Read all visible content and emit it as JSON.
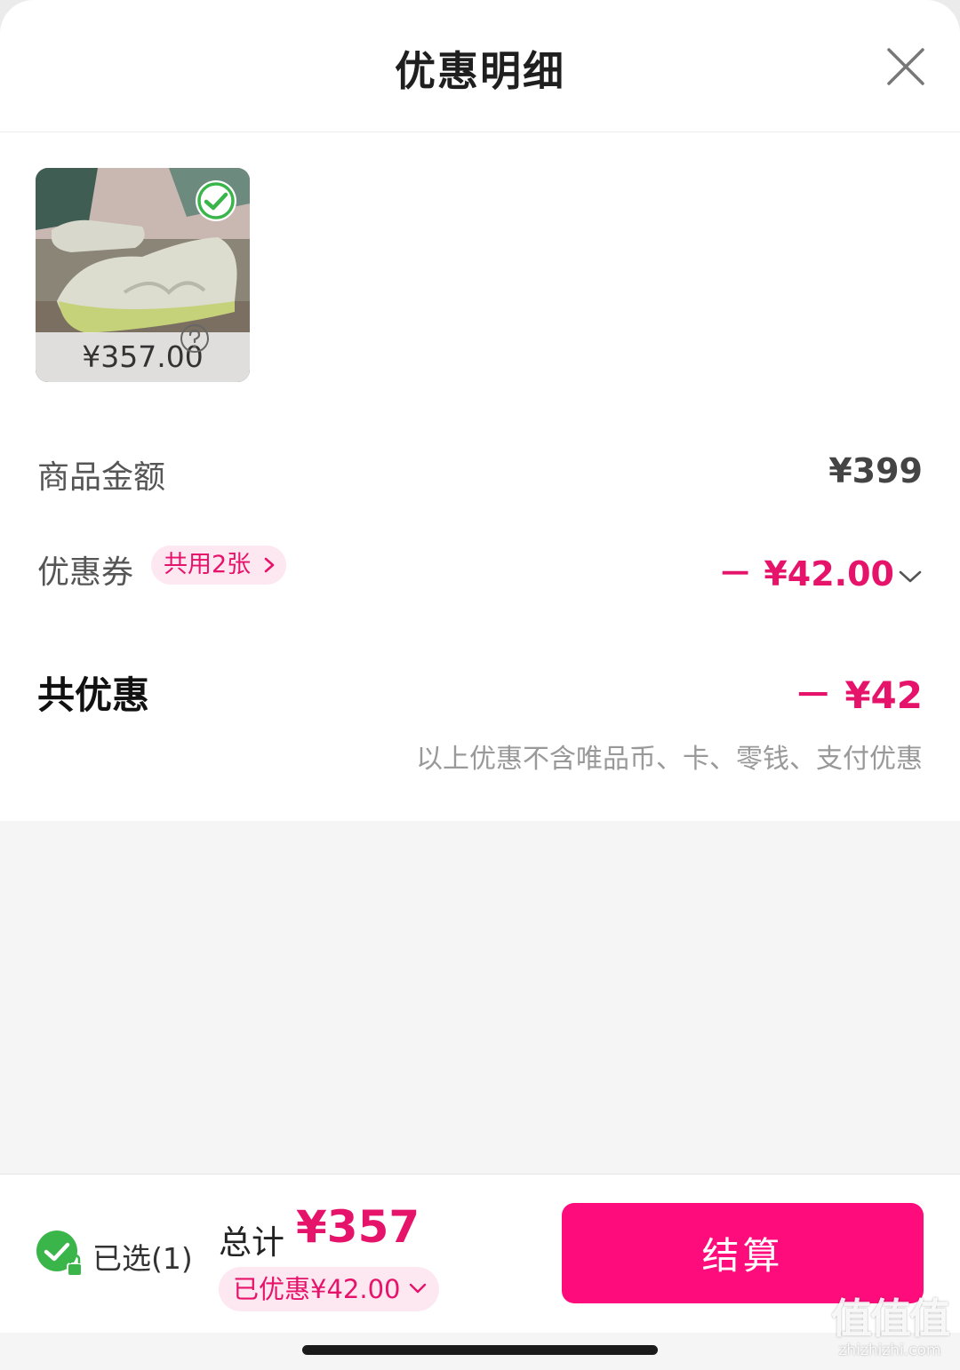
{
  "header": {
    "title": "优惠明细",
    "close_icon": "close-icon"
  },
  "product": {
    "price": "¥357.00",
    "selected": true,
    "image": "running-shoe-photo"
  },
  "rows": {
    "goods_amount": {
      "label": "商品金额",
      "value": "¥399",
      "help_icon": "question-circle-icon"
    },
    "coupon": {
      "label": "优惠券",
      "pill": "共用2张",
      "value": "－ ¥42.00"
    }
  },
  "total_discount": {
    "label": "共优惠",
    "value": "－ ¥42"
  },
  "note": "以上优惠不含唯品币、卡、零钱、支付优惠",
  "bottom_bar": {
    "selected": "已选(1)",
    "total_label": "总计",
    "total_value": "¥357",
    "saved": "已优惠¥42.00",
    "checkout": "结算"
  },
  "watermark": {
    "logo": "值值值",
    "url": "zhizhizhi.com"
  },
  "colors": {
    "accent": "#e6136b",
    "button": "#ff0c7c",
    "pill_bg": "#fde7f1",
    "check_green": "#3ab54a"
  }
}
